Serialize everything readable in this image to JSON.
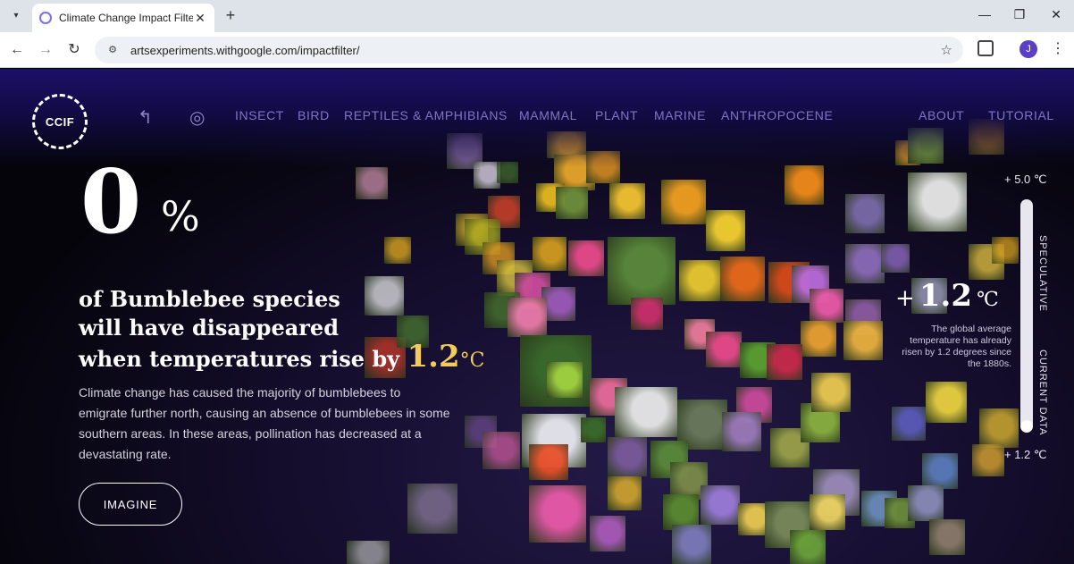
{
  "browser": {
    "tab_title": "Climate Change Impact Filter",
    "url": "artsexperiments.withgoogle.com/impactfilter/",
    "avatar_letter": "J",
    "icons": [
      "tab-search-icon",
      "favicon-icon",
      "close-icon",
      "plus-icon",
      "minimize-icon",
      "restore-icon",
      "close-window-icon",
      "back-icon",
      "forward-icon",
      "reload-icon",
      "site-info-icon",
      "star-icon",
      "extensions-icon",
      "menu-icon"
    ]
  },
  "site": {
    "logo_text": "CCIF",
    "nav": [
      "INSECT",
      "BIRD",
      "REPTILES & AMPHIBIANS",
      "MAMMAL",
      "PLANT",
      "MARINE",
      "ANTHROPOCENE"
    ],
    "nav_right": [
      "ABOUT",
      "TUTORIAL"
    ],
    "icons": [
      "up-arrow-icon",
      "globe-icon"
    ]
  },
  "hero": {
    "value": "0",
    "percent": "%",
    "line1": "of Bumblebee species",
    "line2": "will have disappeared",
    "line3": "when temperatures rise by ",
    "temp": "1.2",
    "unit": "°C",
    "description": "Climate change has caused the majority of bumblebees to emigrate further north, causing an absence of bumblebees in some southern areas. In these areas, pollination has decreased at a devastating rate.",
    "button": "IMAGINE"
  },
  "slider": {
    "top_label": "+ 5.0 ℃",
    "bottom_label": "+ 1.2 ℃",
    "speculative": "SPECULATIVE",
    "current": "CURRENT DATA",
    "current_plus": "+",
    "current_value": "1.2",
    "current_unit": "℃",
    "note": "The global average temperature has already risen by 1.2 degrees since the 1880s.",
    "value_fraction": 0
  },
  "colors": {
    "accent": "#f2cc5a",
    "nav": "#7e76c4",
    "header": "#1b1066"
  }
}
